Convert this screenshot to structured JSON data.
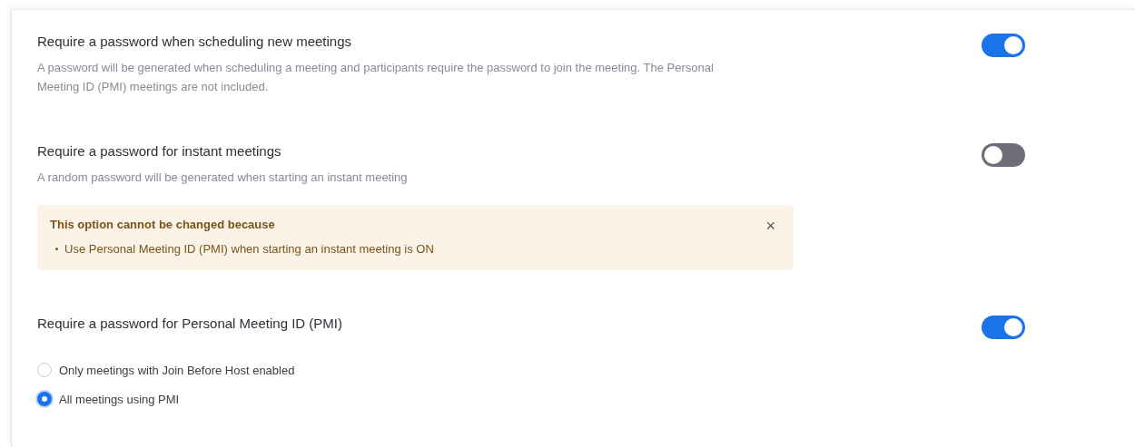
{
  "settings": [
    {
      "kind": "toggle",
      "title": "Require a password when scheduling new meetings",
      "description": "A password will be generated when scheduling a meeting and participants require the password to join the meeting. The Personal Meeting ID (PMI) meetings are not included.",
      "on": true
    },
    {
      "kind": "toggle",
      "title": "Require a password for instant meetings",
      "description": "A random password will be generated when starting an instant meeting",
      "on": false,
      "notice": {
        "title": "This option cannot be changed because",
        "items": [
          "Use Personal Meeting ID (PMI) when starting an instant meeting is ON"
        ],
        "close": "×"
      }
    },
    {
      "kind": "toggle",
      "title": "Require a password for Personal Meeting ID (PMI)",
      "on": true,
      "options": [
        {
          "label": "Only meetings with Join Before Host enabled",
          "selected": false
        },
        {
          "label": "All meetings using PMI",
          "selected": true
        }
      ]
    }
  ]
}
